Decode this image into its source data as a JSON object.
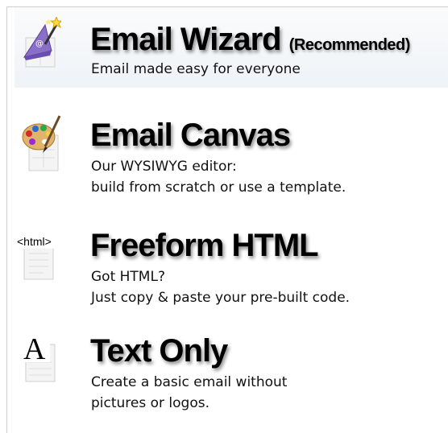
{
  "options": [
    {
      "icon": "wizard-hat-icon",
      "title": "Email Wizard",
      "tag": "(Recommended)",
      "lines": [
        "Email made easy for everyone"
      ]
    },
    {
      "icon": "paint-palette-icon",
      "title": "Email Canvas",
      "lines": [
        "Our WYSIWYG editor:",
        "build from scratch or use a template."
      ]
    },
    {
      "icon": "html-document-icon",
      "icon_text": "<html>",
      "title": "Freeform HTML",
      "lines": [
        "Got HTML?",
        "Just copy & paste your pre-built code."
      ]
    },
    {
      "icon": "text-document-icon",
      "icon_text": "A",
      "title": "Text Only",
      "lines": [
        "Create a basic email without",
        "pictures or logos."
      ]
    }
  ],
  "colors": {
    "highlight_bg": "#eef3f8",
    "border": "#cfcfcf",
    "wizard_hat": "#8a6fc8",
    "palette": "#e0b46a"
  }
}
